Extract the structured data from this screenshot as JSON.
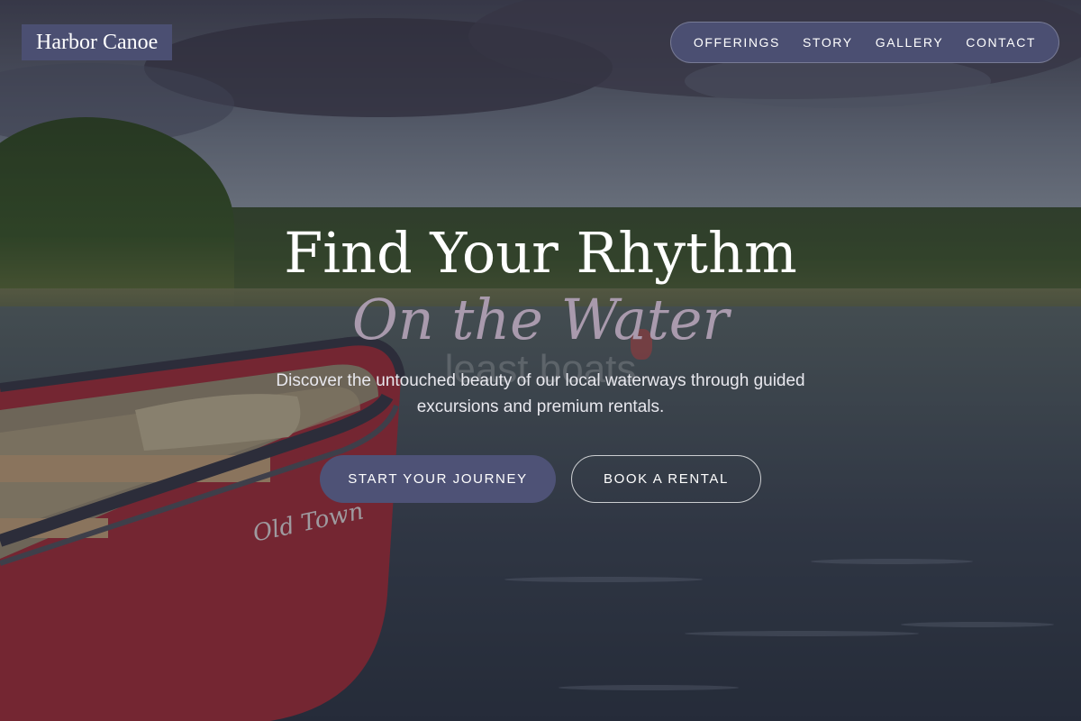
{
  "brand": {
    "name": "Harbor Canoe"
  },
  "nav": {
    "items": [
      "OFFERINGS",
      "STORY",
      "GALLERY",
      "CONTACT"
    ]
  },
  "hero": {
    "title": "Find Your Rhythm",
    "subtitle": "On the Water",
    "ghost_text": "least boats",
    "description": "Discover the untouched beauty of our local waterways through guided excursions and premium rentals.",
    "primary_cta": "START YOUR JOURNEY",
    "secondary_cta": "BOOK A RENTAL"
  },
  "canoe": {
    "label": "Old Town"
  },
  "colors": {
    "accent": "#4b4f72",
    "subtitle": "#a99aad",
    "canoe_hull": "#a82f3a"
  }
}
